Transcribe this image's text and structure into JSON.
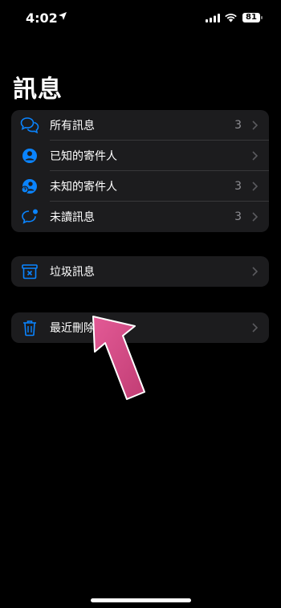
{
  "status": {
    "time": "4:02",
    "battery": "81"
  },
  "page": {
    "title": "訊息"
  },
  "group_main": [
    {
      "label": "所有訊息",
      "count": "3",
      "icon": "chat-bubbles-icon"
    },
    {
      "label": "已知的寄件人",
      "count": "",
      "icon": "person-circle-icon"
    },
    {
      "label": "未知的寄件人",
      "count": "3",
      "icon": "person-question-icon"
    },
    {
      "label": "未讀訊息",
      "count": "3",
      "icon": "unread-bubble-icon"
    }
  ],
  "junk": {
    "label": "垃圾訊息",
    "icon": "junk-tray-icon"
  },
  "recent_deleted": {
    "label": "最近刪除",
    "icon": "trash-icon"
  },
  "colors": {
    "accent": "#0a84ff",
    "annotation_arrow": "#d04a82"
  }
}
